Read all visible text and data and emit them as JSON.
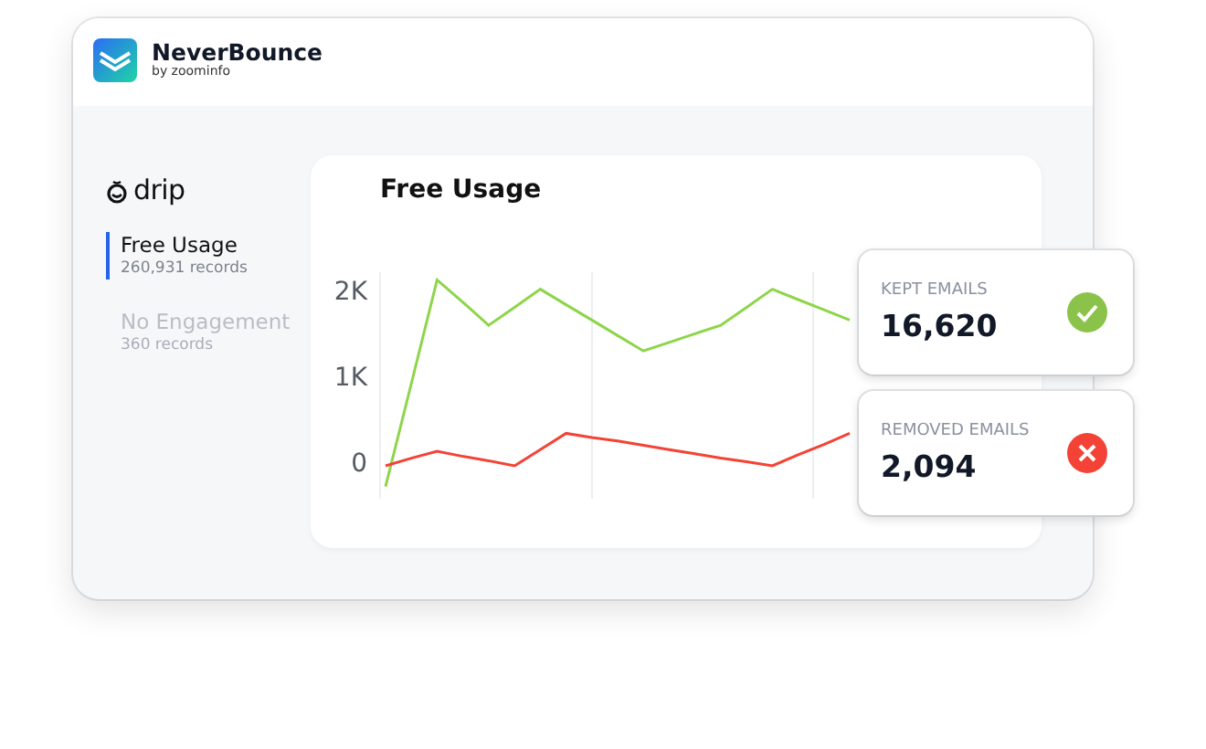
{
  "brand": {
    "name": "NeverBounce",
    "byline": "by zoominfo"
  },
  "account": {
    "name": "drip"
  },
  "lists": [
    {
      "name": "Free Usage",
      "records": "260,931 records",
      "selected": true
    },
    {
      "name": "No Engagement",
      "records": "360 records",
      "selected": false
    }
  ],
  "panel": {
    "title": "Free Usage",
    "chart_data": {
      "type": "line",
      "categories": [
        null,
        null,
        null,
        null,
        null,
        null,
        null,
        null,
        null,
        null,
        null,
        null,
        null,
        null,
        null,
        null,
        null,
        null,
        null
      ],
      "ylim": [
        -400,
        2200
      ],
      "yticks": [
        {
          "value": 0,
          "label": "0"
        },
        {
          "value": 1000,
          "label": "1K"
        },
        {
          "value": 2000,
          "label": "2K"
        }
      ],
      "series": [
        {
          "color": "#8ed54a",
          "values": [
            -280,
            920,
            2130,
            1870,
            1600,
            1810,
            2020,
            1840,
            1660,
            1480,
            1300,
            1400,
            1500,
            1600,
            1810,
            2020,
            1900,
            1780,
            1660
          ]
        },
        {
          "color": "#f44336",
          "values": [
            -40,
            50,
            130,
            70,
            20,
            -40,
            150,
            340,
            290,
            250,
            200,
            150,
            100,
            50,
            10,
            -40,
            90,
            210,
            340
          ]
        }
      ]
    }
  },
  "stats": [
    {
      "label": "KEPT EMAILS",
      "value": "16,620",
      "kind": "kept"
    },
    {
      "label": "REMOVED EMAILS",
      "value": "2,094",
      "kind": "removed"
    }
  ]
}
